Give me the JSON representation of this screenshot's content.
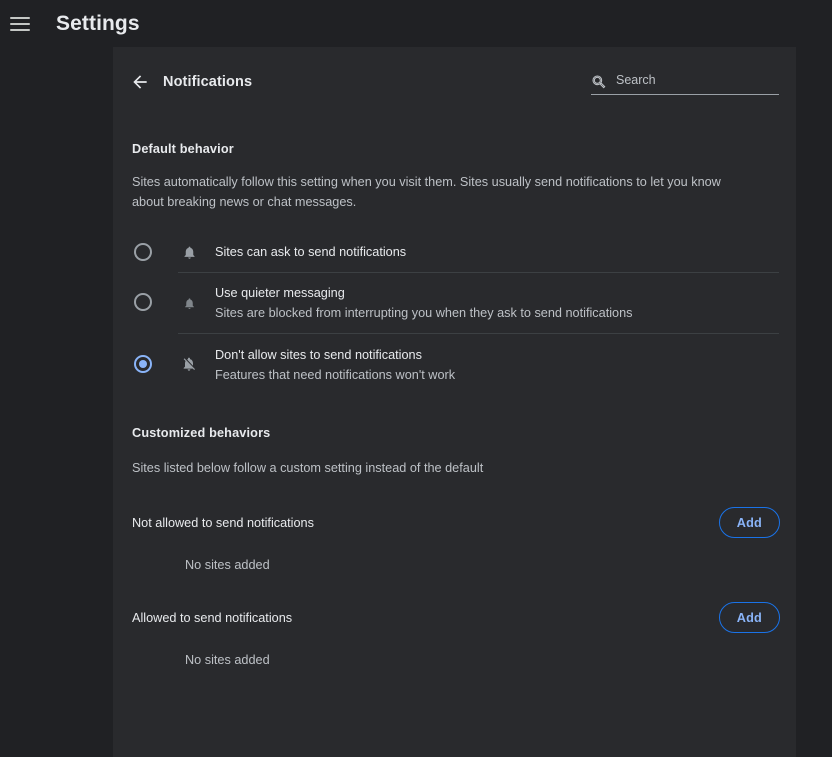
{
  "window": {
    "app_title": "Settings",
    "menu_icon": "hamburger-menu-icon"
  },
  "header": {
    "back_icon": "arrow-left-icon",
    "page_title": "Notifications",
    "search": {
      "icon": "search-icon",
      "placeholder": "Search",
      "value": ""
    }
  },
  "default_behavior": {
    "title": "Default behavior",
    "description": "Sites automatically follow this setting when you visit them. Sites usually send notifications to let you know about breaking news or chat messages.",
    "options": [
      {
        "id": "ask",
        "icon": "bell-icon",
        "label": "Sites can ask to send notifications",
        "sublabel": "",
        "selected": false
      },
      {
        "id": "quieter",
        "icon": "bell-quiet-icon",
        "label": "Use quieter messaging",
        "sublabel": "Sites are blocked from interrupting you when they ask to send notifications",
        "selected": false
      },
      {
        "id": "block",
        "icon": "bell-off-icon",
        "label": "Don't allow sites to send notifications",
        "sublabel": "Features that need notifications won't work",
        "selected": true
      }
    ]
  },
  "customized_behaviors": {
    "title": "Customized behaviors",
    "description": "Sites listed below follow a custom setting instead of the default",
    "lists": [
      {
        "id": "blocked",
        "label": "Not allowed to send notifications",
        "add_label": "Add",
        "empty_text": "No sites added"
      },
      {
        "id": "allowed",
        "label": "Allowed to send notifications",
        "add_label": "Add",
        "empty_text": "No sites added"
      }
    ]
  },
  "colors": {
    "window_background": "#202124",
    "content_background": "#292a2d",
    "primary_text": "#e8eaed",
    "secondary_text": "#bdc1c6",
    "accent_blue": "#8ab4f8",
    "accent_border": "#1a73e8",
    "divider": "#3c4043",
    "icon_gray": "#9aa0a6"
  }
}
